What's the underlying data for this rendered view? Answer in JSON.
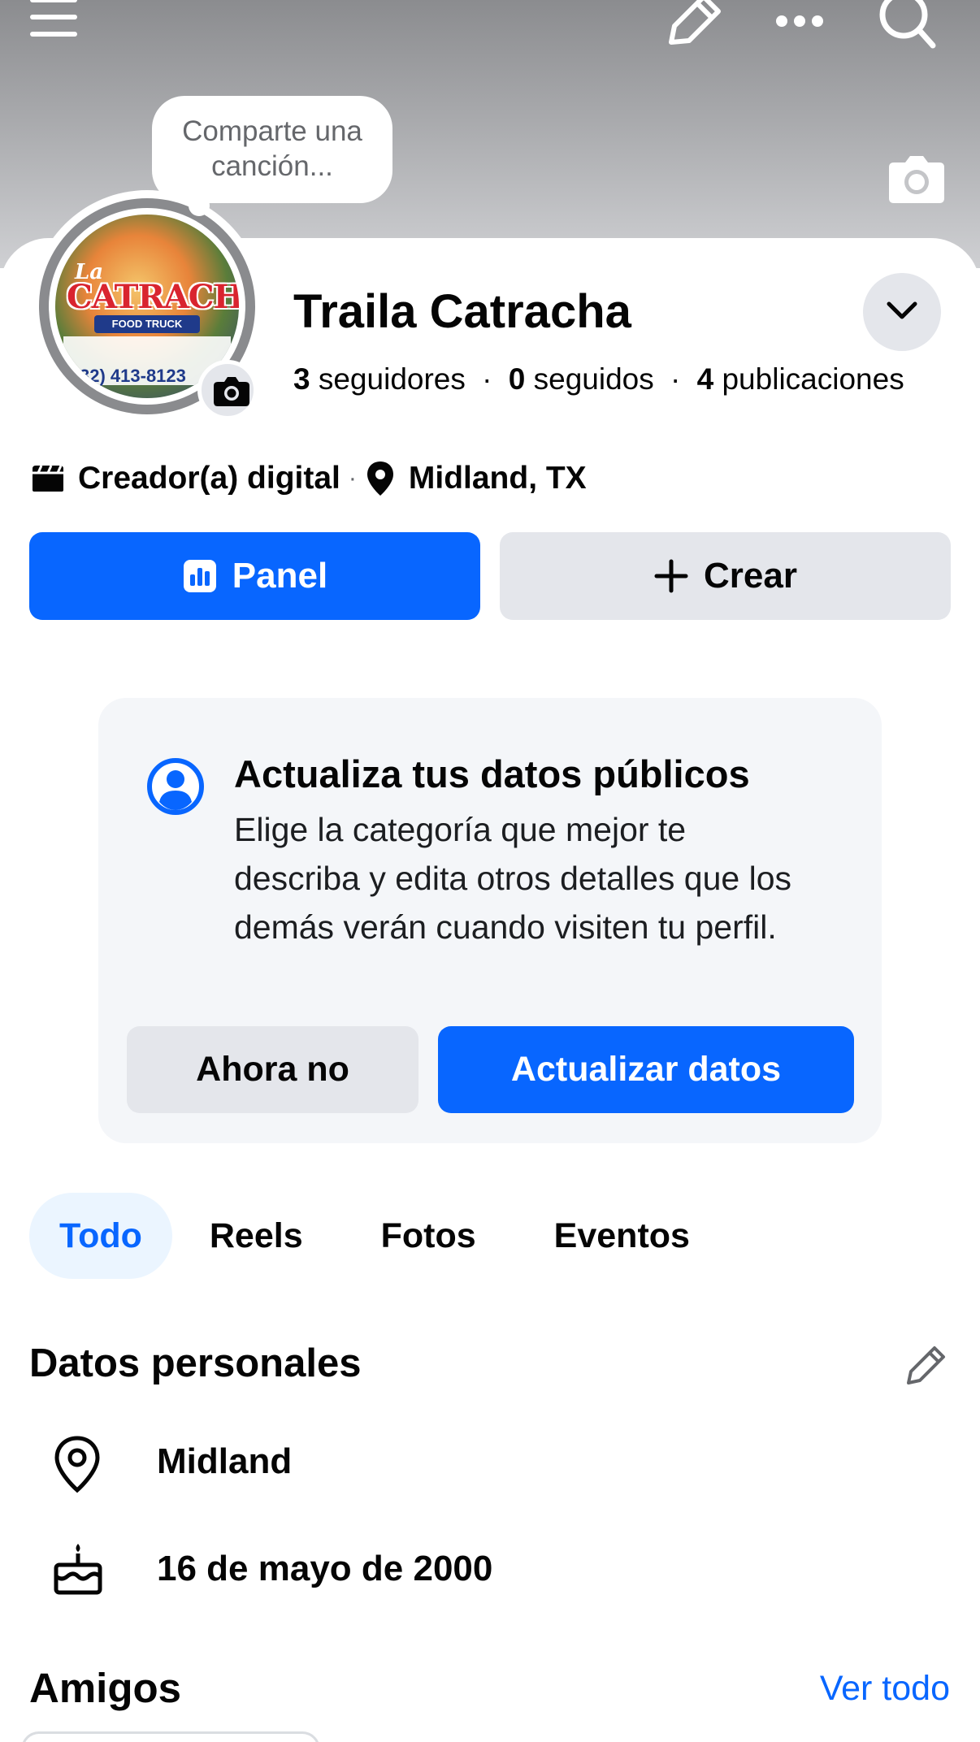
{
  "colors": {
    "accent": "#0866ff",
    "button_gray": "#e4e6eb",
    "notice_bg": "#f4f6f9",
    "tab_active_bg": "#ebf5ff"
  },
  "topbar": {
    "icons": [
      "menu-icon",
      "pencil-icon",
      "more-icon",
      "search-icon"
    ]
  },
  "cover": {
    "song_bubble": "Comparte una canción..."
  },
  "avatar": {
    "logo_prefix": "La",
    "logo_name": "CATRACHA",
    "logo_subtitle": "FOOD TRUCK",
    "logo_phone": "32) 413-8123"
  },
  "profile": {
    "name": "Traila Catracha",
    "followers_count": "3",
    "followers_label": "seguidores",
    "following_count": "0",
    "following_label": "seguidos",
    "posts_count": "4",
    "posts_label": "publicaciones",
    "category": "Creador(a) digital",
    "location": "Midland, TX"
  },
  "actions": {
    "panel_label": "Panel",
    "create_label": "Crear"
  },
  "notice": {
    "title": "Actualiza tus datos públicos",
    "body": "Elige la categoría que mejor te describa y edita otros detalles que los demás verán cuando visiten tu perfil.",
    "dismiss_label": "Ahora no",
    "confirm_label": "Actualizar datos"
  },
  "tabs": [
    {
      "label": "Todo",
      "active": true
    },
    {
      "label": "Reels",
      "active": false
    },
    {
      "label": "Fotos",
      "active": false
    },
    {
      "label": "Eventos",
      "active": false
    }
  ],
  "personal": {
    "title": "Datos personales",
    "city": "Midland",
    "birthday": "16 de mayo de 2000"
  },
  "friends": {
    "title": "Amigos",
    "see_all_label": "Ver todo"
  }
}
